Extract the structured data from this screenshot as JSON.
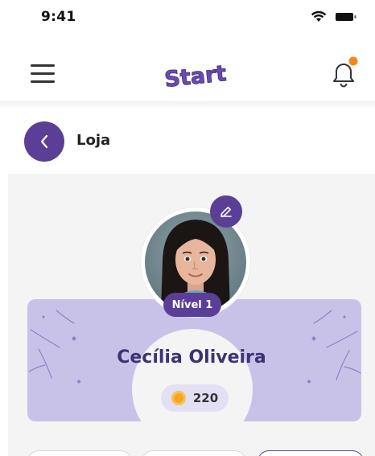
{
  "status_bar": {
    "time": "9:41",
    "icons": [
      "wifi-icon",
      "battery-icon"
    ]
  },
  "app_bar": {
    "logo_text": "Start",
    "menu_icon": "hamburger-menu-icon",
    "notification_icon": "bell-icon",
    "has_unread_notification": true
  },
  "page_header": {
    "back_icon": "chevron-left-icon",
    "title": "Loja"
  },
  "profile": {
    "name": "Cecília Oliveira",
    "level_label": "Nível 1",
    "coins": "220",
    "edit_icon": "pencil-icon",
    "coin_icon": "coin-icon"
  },
  "tabs": [
    {
      "label": "",
      "active": false
    },
    {
      "label": "",
      "active": false
    },
    {
      "label": "",
      "active": true
    }
  ],
  "colors": {
    "primary": "#5b3f96",
    "card_background": "#c9c2e8",
    "name_text": "#3f3274",
    "notification_dot": "#f5861f",
    "coin": "#f5a623"
  }
}
